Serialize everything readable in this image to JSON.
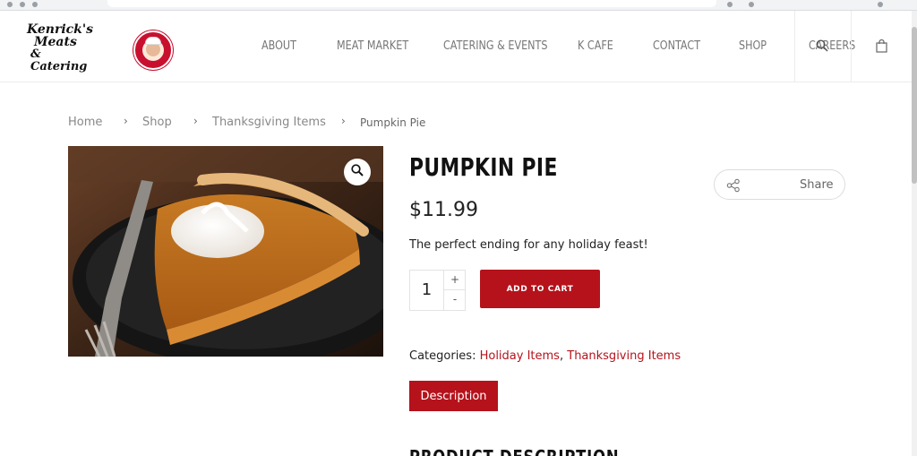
{
  "header": {
    "nav_items": [
      "ABOUT",
      "MEAT MARKET",
      "CATERING & EVENTS",
      "K CAFE",
      "CONTACT",
      "SHOP",
      "CAREERS"
    ],
    "logo_text": [
      "Kenrick's",
      "Meats",
      "& Catering"
    ]
  },
  "breadcrumb": {
    "items": [
      "Home",
      "Shop",
      "Thanksgiving Items"
    ],
    "current": "Pumpkin Pie"
  },
  "product": {
    "title": "PUMPKIN PIE",
    "price": "$11.99",
    "description": "The perfect ending for any holiday feast!",
    "quantity": "1",
    "qty_plus": "+",
    "qty_minus": "-",
    "add_to_cart_label": "ADD TO CART",
    "share_label": "Share",
    "categories_label": "Categories:",
    "categories": [
      "Holiday Items",
      "Thanksgiving Items"
    ],
    "category_separator": ",",
    "tab_label": "Description",
    "section_heading": "PRODUCT DESCRIPTION"
  },
  "icons": {
    "zoom": "magnifier-icon",
    "search": "search-icon",
    "cart": "shopping-bag-icon",
    "share": "share-icon"
  },
  "colors": {
    "accent": "#b5121b",
    "nav_text": "#777777",
    "border": "#ececec"
  }
}
